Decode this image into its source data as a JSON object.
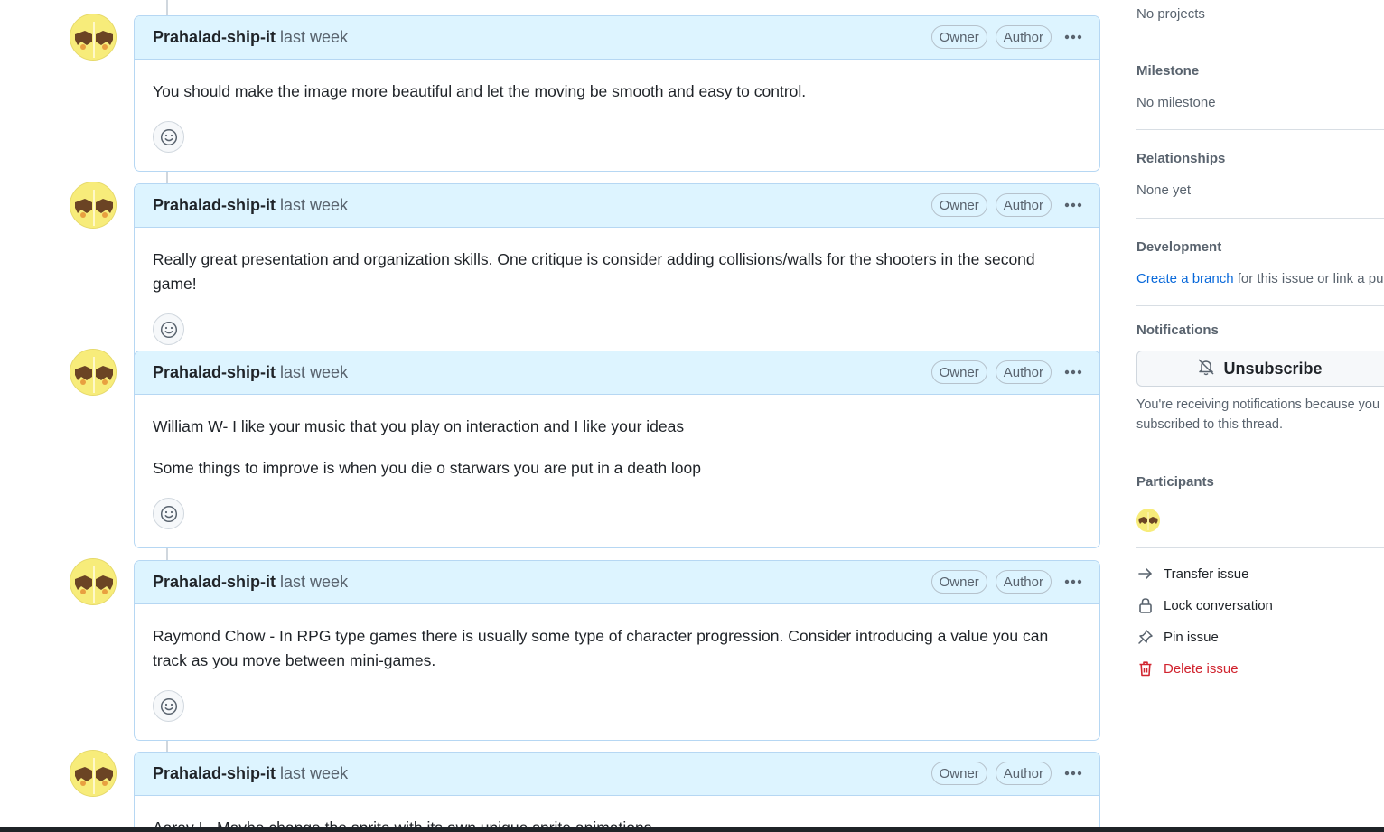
{
  "comments": [
    {
      "author": "Prahalad-ship-it",
      "time": "last week",
      "badges": [
        "Owner",
        "Author"
      ],
      "paragraphs": [
        "You should make the image more beautiful and let the moving be smooth and easy to control."
      ]
    },
    {
      "author": "Prahalad-ship-it",
      "time": "last week",
      "badges": [
        "Owner",
        "Author"
      ],
      "paragraphs": [
        "Really great presentation and organization skills. One critique is consider adding collisions/walls for the shooters in the second game!"
      ]
    },
    {
      "author": "Prahalad-ship-it",
      "time": "last week",
      "badges": [
        "Owner",
        "Author"
      ],
      "paragraphs": [
        "William W- I like your music that you play on interaction and I like your ideas",
        "Some things to improve is when you die o starwars you are put in a death loop"
      ]
    },
    {
      "author": "Prahalad-ship-it",
      "time": "last week",
      "badges": [
        "Owner",
        "Author"
      ],
      "paragraphs": [
        "Raymond Chow - In RPG type games there is usually some type of character progression. Consider introducing a value you can track as you move between mini-games."
      ]
    },
    {
      "author": "Prahalad-ship-it",
      "time": "last week",
      "badges": [
        "Owner",
        "Author"
      ],
      "paragraphs": [
        "Aarav I - Maybe change the sprite with its own unique sprite animations"
      ]
    }
  ],
  "sidebar": {
    "projects_value": "No projects",
    "milestone_label": "Milestone",
    "milestone_value": "No milestone",
    "relationships_label": "Relationships",
    "relationships_value": "None yet",
    "development_label": "Development",
    "development_link": "Create a branch",
    "development_rest": " for this issue or link a pul",
    "notifications_label": "Notifications",
    "unsubscribe_label": "Unsubscribe",
    "notif_reason_line1": "You're receiving notifications because you",
    "notif_reason_line2": "subscribed to this thread.",
    "participants_label": "Participants",
    "actions": {
      "transfer": "Transfer issue",
      "lock": "Lock conversation",
      "pin": "Pin issue",
      "delete": "Delete issue"
    }
  },
  "icons": {
    "comment_menu": "kebab-horizontal-icon",
    "emoji": "smiley-icon",
    "unsubscribe": "bell-slash-icon",
    "transfer": "arrow-right-icon",
    "lock": "lock-icon",
    "pin": "pin-icon",
    "delete": "trash-icon"
  },
  "colors": {
    "header_bg": "#ddf4ff",
    "border": "#b6d7f3",
    "link": "#0969da",
    "danger": "#d1242f"
  }
}
